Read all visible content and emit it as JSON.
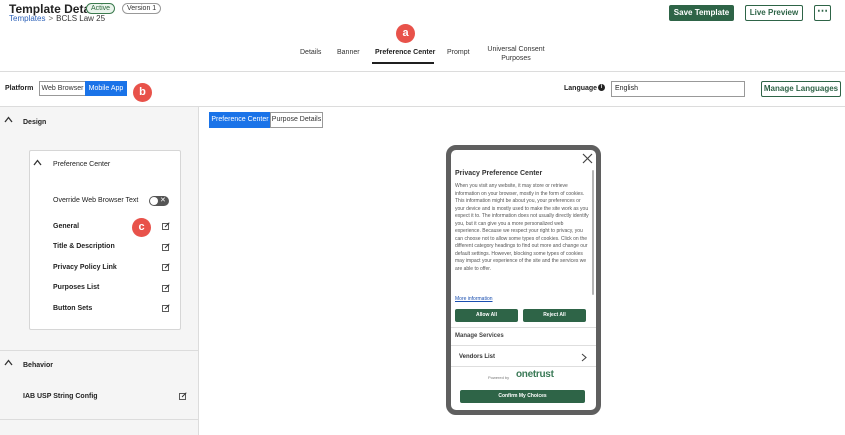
{
  "header": {
    "title": "Template Details",
    "status_badge": "Active",
    "version_badge": "Version 1",
    "breadcrumb_link": "Templates",
    "breadcrumb_separator": ">",
    "breadcrumb_current": "BCLS Law 25",
    "save_label": "Save Template",
    "preview_label": "Live Preview",
    "more_label": "⋯"
  },
  "tabs": [
    {
      "label": "Details"
    },
    {
      "label": "Banner"
    },
    {
      "label": "Preference Center"
    },
    {
      "label": "Prompt"
    },
    {
      "label": "Universal Consent Purposes"
    }
  ],
  "annotations": {
    "a": "a",
    "b": "b",
    "c": "c"
  },
  "platform": {
    "label": "Platform",
    "options": [
      "Web Browser",
      "Mobile App"
    ],
    "selected": "Mobile App"
  },
  "language": {
    "label": "Language",
    "value": "English",
    "manage_label": "Manage Languages"
  },
  "sidebar": {
    "design_label": "Design",
    "card_title": "Preference Center",
    "override_label": "Override Web Browser Text",
    "items": [
      "General",
      "Title & Description",
      "Privacy Policy Link",
      "Purposes List",
      "Button Sets"
    ],
    "behavior_label": "Behavior",
    "behavior_items": [
      "IAB USP String Config"
    ]
  },
  "preview_tabs": [
    "Preference Center",
    "Purpose Details"
  ],
  "preview": {
    "title": "Privacy Preference Center",
    "body": "When you visit any website, it may store or retrieve information on your browser, mostly in the form of cookies. This information might be about you, your preferences or your device and is mostly used to make the site work as you expect it to. The information does not usually directly identify you, but it can give you a more personalized web experience. Because we respect your right to privacy, you can choose not to allow some types of cookies. Click on the different category headings to find out more and change our default settings. However, blocking some types of cookies may impact your experience of the site and the services we are able to offer.",
    "more_info": "More information",
    "allow_all": "Allow All",
    "reject_all": "Reject All",
    "manage_services": "Manage Services",
    "vendors_list": "Vendors List",
    "powered_by": "Powered by",
    "brand": "onetrust",
    "confirm": "Confirm My Choices"
  },
  "colors": {
    "primary_green": "#2e6447",
    "selected_blue": "#1a73e8",
    "annotation_red": "#e8524a"
  }
}
